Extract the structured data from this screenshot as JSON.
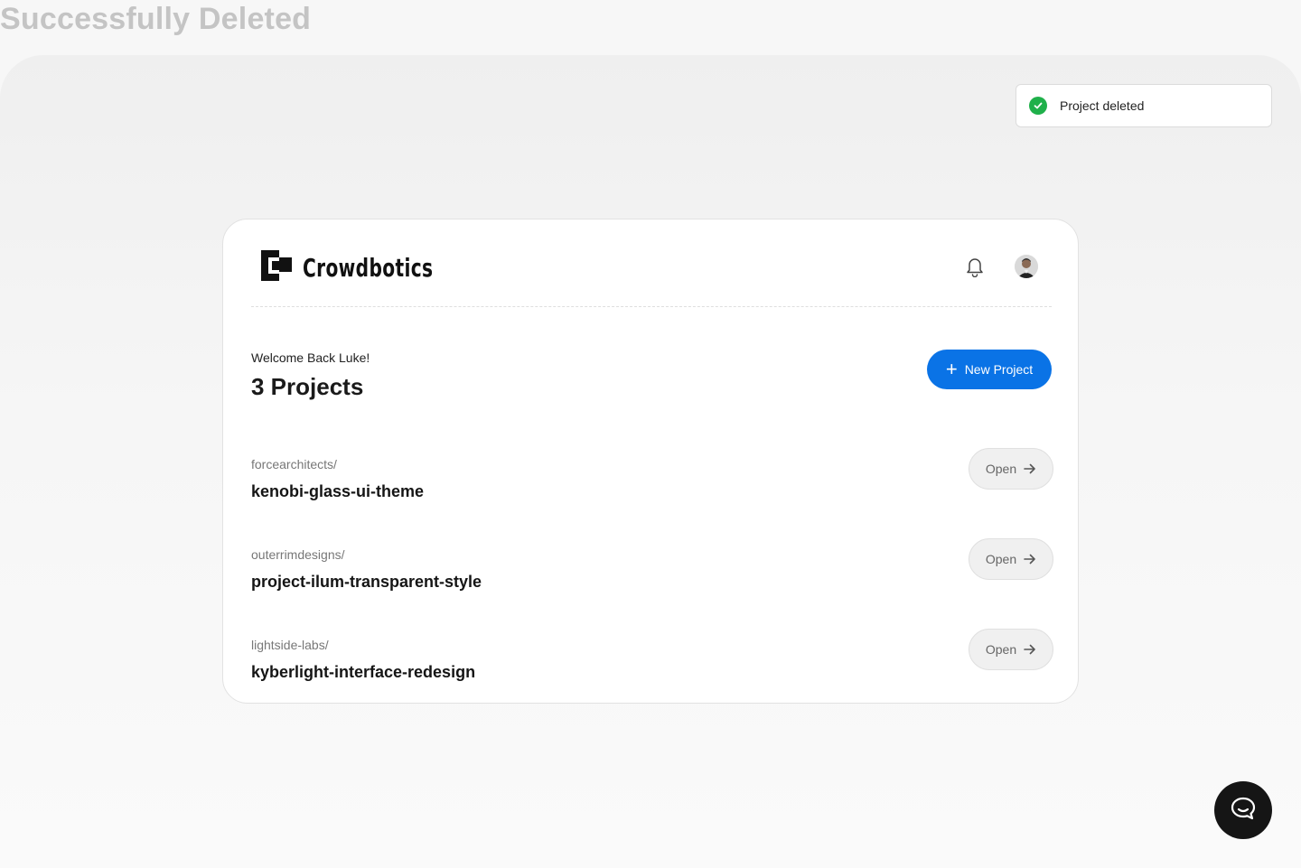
{
  "page": {
    "heading": "Successfully Deleted"
  },
  "toast": {
    "message": "Project deleted",
    "icon": "check-circle-icon",
    "color": "#1fb04a"
  },
  "header": {
    "brand": "Crowdbotics"
  },
  "main": {
    "welcome": "Welcome Back Luke!",
    "count_label": "3 Projects",
    "new_project_label": "New Project",
    "accent": "#0a73e6"
  },
  "projects": [
    {
      "org": "forcearchitects/",
      "name": "kenobi-glass-ui-theme",
      "action": "Open"
    },
    {
      "org": "outerrimdesigns/",
      "name": "project-ilum-transparent-style",
      "action": "Open"
    },
    {
      "org": "lightside-labs/",
      "name": "kyberlight-interface-redesign",
      "action": "Open"
    }
  ]
}
